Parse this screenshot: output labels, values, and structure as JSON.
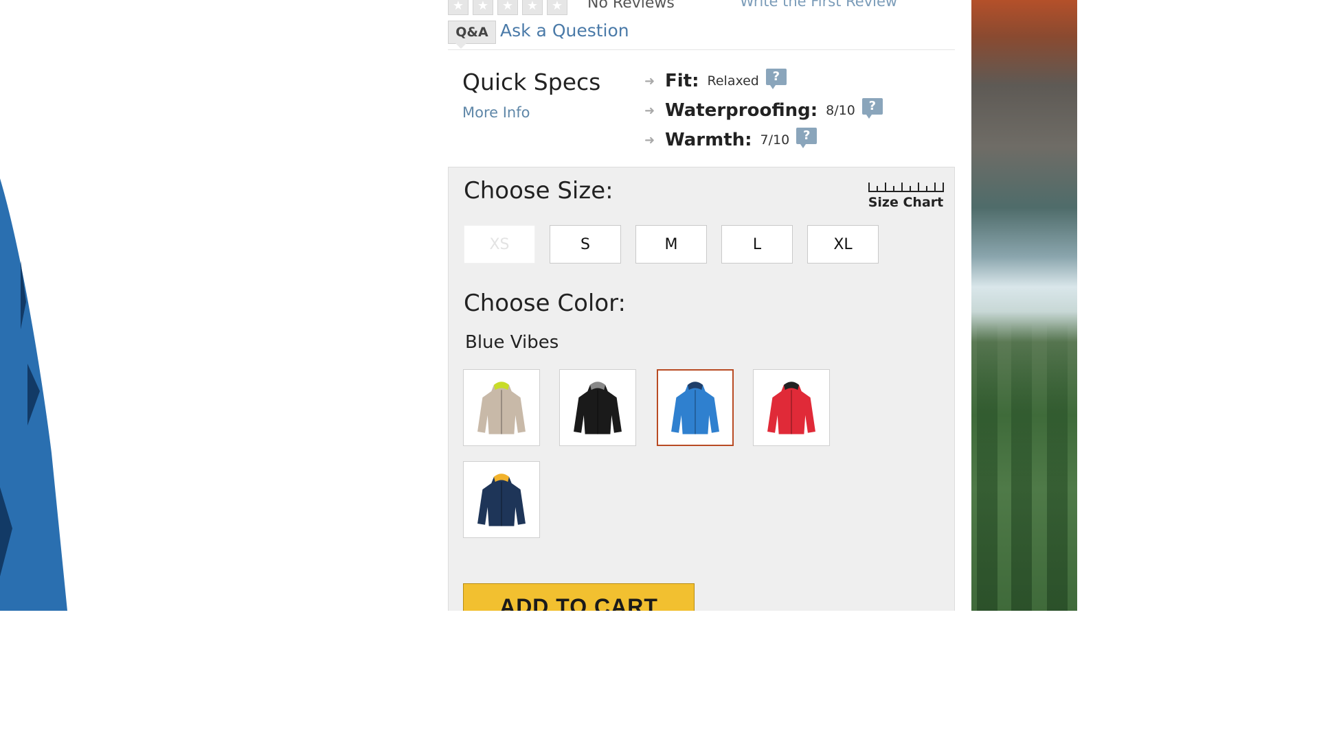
{
  "reviews": {
    "stars_filled": 0,
    "stars_total": 5,
    "no_reviews_label": "No Reviews",
    "write_review_label": "Write the First Review"
  },
  "qa": {
    "badge": "Q&A",
    "ask_label": "Ask a Question"
  },
  "quick_specs": {
    "title": "Quick Specs",
    "more_info": "More Info",
    "items": [
      {
        "label": "Fit:",
        "value": "Relaxed",
        "help": "?"
      },
      {
        "label": "Waterproofing:",
        "value": "8/10",
        "help": "?"
      },
      {
        "label": "Warmth:",
        "value": "7/10",
        "help": "?"
      }
    ]
  },
  "size": {
    "title": "Choose Size:",
    "chart_label": "Size Chart",
    "options": [
      {
        "label": "XS",
        "available": false
      },
      {
        "label": "S",
        "available": true
      },
      {
        "label": "M",
        "available": true
      },
      {
        "label": "L",
        "available": true
      },
      {
        "label": "XL",
        "available": true
      }
    ]
  },
  "color": {
    "title": "Choose Color:",
    "selected_name": "Blue Vibes",
    "swatches": [
      {
        "body": "#c8b9a8",
        "accent": "#c8dc28"
      },
      {
        "body": "#1a1a1a",
        "accent": "#888888"
      },
      {
        "body": "#2f80cf",
        "accent": "#1f3f6a",
        "selected": true
      },
      {
        "body": "#e02a38",
        "accent": "#222222"
      },
      {
        "body": "#1e3558",
        "accent": "#f1b22c"
      }
    ]
  },
  "cart": {
    "add_label": "ADD TO CART"
  },
  "colors": {
    "link_blue": "#4a7aa8",
    "accent_yellow": "#f2c030",
    "selected_border": "#b84a22",
    "help_blue": "#8aa5bb"
  }
}
